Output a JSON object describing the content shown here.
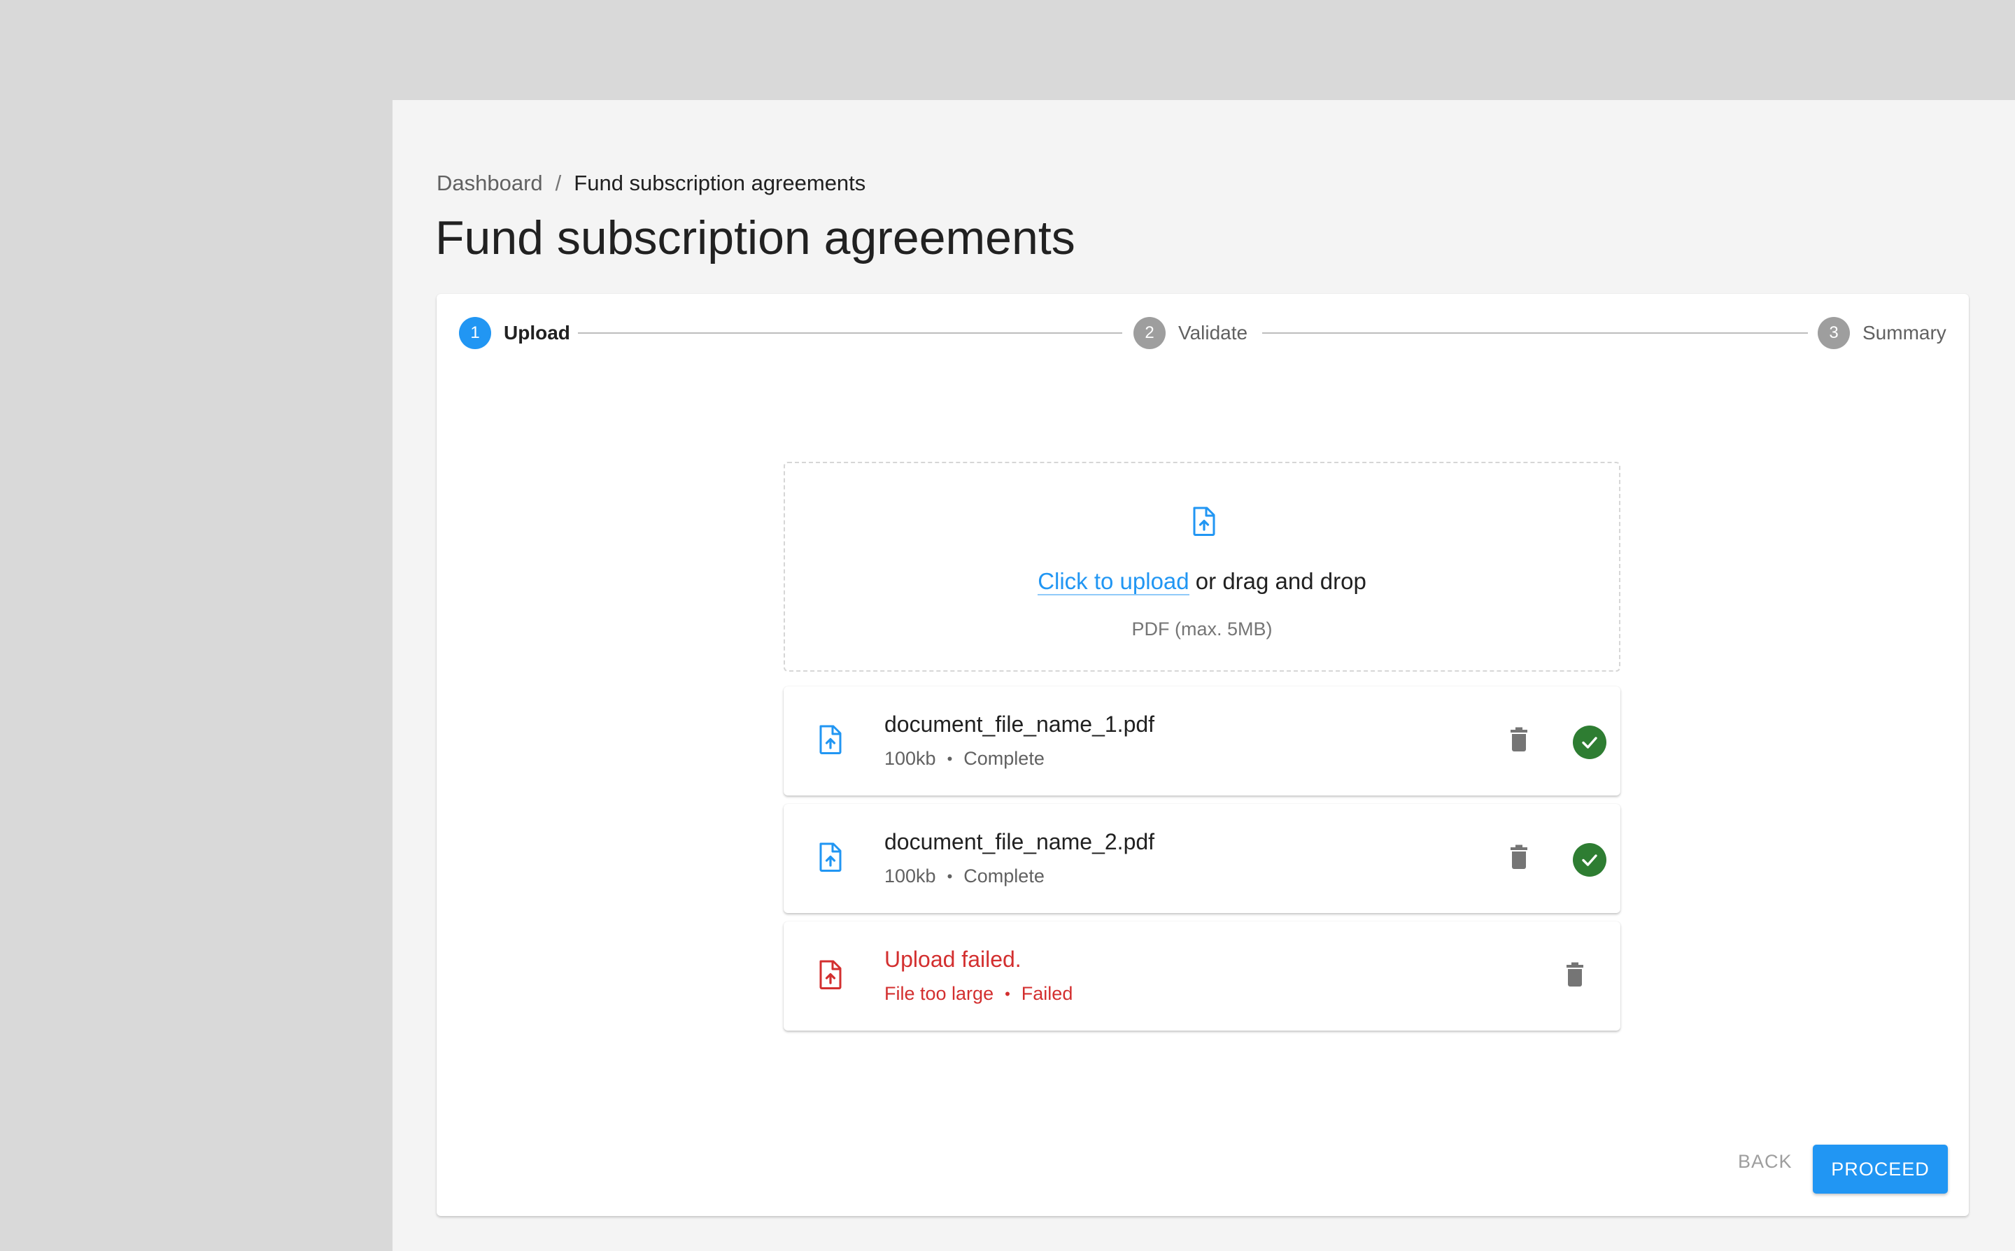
{
  "breadcrumb": {
    "parent": "Dashboard",
    "separator": "/",
    "current": "Fund subscription agreements"
  },
  "page": {
    "title": "Fund subscription agreements"
  },
  "stepper": {
    "steps": [
      {
        "number": "1",
        "label": "Upload",
        "state": "active"
      },
      {
        "number": "2",
        "label": "Validate",
        "state": "inactive"
      },
      {
        "number": "3",
        "label": "Summary",
        "state": "inactive"
      }
    ]
  },
  "dropzone": {
    "icon": "upload-file-icon",
    "link_text": "Click to upload",
    "rest_text": " or drag and drop",
    "hint": "PDF (max. 5MB)"
  },
  "files": [
    {
      "name": "document_file_name_1.pdf",
      "size": "100kb",
      "separator": "•",
      "status": "Complete",
      "state": "complete"
    },
    {
      "name": "document_file_name_2.pdf",
      "size": "100kb",
      "separator": "•",
      "status": "Complete",
      "state": "complete"
    },
    {
      "name": "Upload failed.",
      "size": "File too large",
      "separator": "•",
      "status": "Failed",
      "state": "error"
    }
  ],
  "colors": {
    "primary": "#2196f3",
    "success": "#2e7d32",
    "error": "#d32f2f",
    "icon_gray": "#757575"
  },
  "actions": {
    "back_label": "BACK",
    "proceed_label": "PROCEED"
  }
}
